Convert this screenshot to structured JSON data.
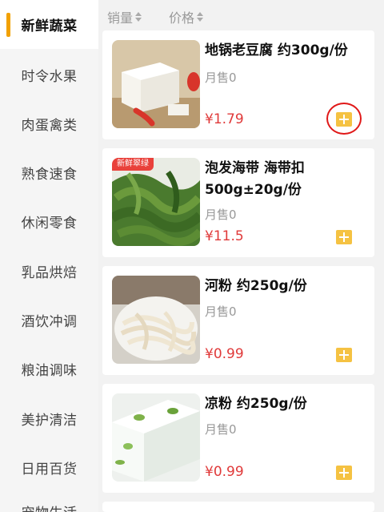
{
  "sidebar": {
    "items": [
      {
        "label": "新鲜蔬菜",
        "active": true
      },
      {
        "label": "时令水果"
      },
      {
        "label": "肉蛋禽类"
      },
      {
        "label": "熟食速食"
      },
      {
        "label": "休闲零食"
      },
      {
        "label": "乳品烘焙"
      },
      {
        "label": "酒饮冲调"
      },
      {
        "label": "粮油调味"
      },
      {
        "label": "美护清洁"
      },
      {
        "label": "日用百货"
      },
      {
        "label": "宠物生活"
      }
    ]
  },
  "sort": {
    "sales_label": "销量",
    "price_label": "价格"
  },
  "products": [
    {
      "title": "地锅老豆腐 约300g/份",
      "sales": "月售0",
      "price": "¥1.79"
    },
    {
      "title": "泡发海带 海带扣 500g±20g/份",
      "sales": "月售0",
      "price": "¥11.5",
      "tag": "新鲜翠绿"
    },
    {
      "title": "河粉 约250g/份",
      "sales": "月售0",
      "price": "¥0.99"
    },
    {
      "title": "凉粉 约250g/份",
      "sales": "月售0",
      "price": "¥0.99"
    }
  ],
  "colors": {
    "accent": "#f2a100",
    "price": "#e03a3a",
    "add_button": "#f5c242",
    "highlight_circle": "#e01818"
  }
}
